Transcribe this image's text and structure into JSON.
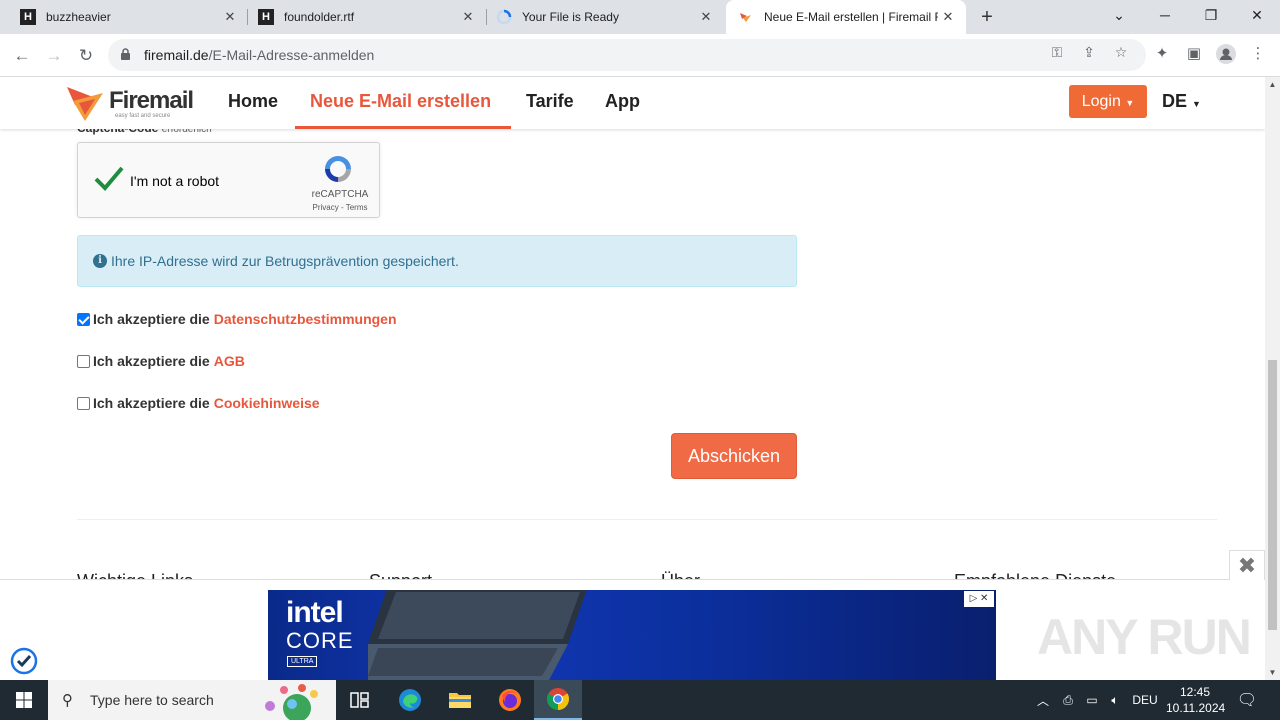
{
  "browser": {
    "tabs": [
      {
        "title": "buzzheavier",
        "favicon": "H",
        "active": false
      },
      {
        "title": "foundolder.rtf",
        "favicon": "H",
        "active": false
      },
      {
        "title": "Your File is Ready",
        "favicon": "loading-icon",
        "active": false
      },
      {
        "title": "Neue E-Mail erstellen | Firemail F",
        "favicon": "firemail-icon",
        "active": true
      }
    ],
    "url_domain": "firemail.de",
    "url_path": "/E-Mail-Adresse-anmelden"
  },
  "site": {
    "logo_text": "Firemail",
    "logo_tagline": "easy fast and secure",
    "nav": [
      "Home",
      "Neue E-Mail erstellen",
      "Tarife",
      "App"
    ],
    "login_label": "Login",
    "lang_label": "DE",
    "accent_color": "#e8573c"
  },
  "form": {
    "captcha_label": "Captcha-Code",
    "captcha_sub": "erforderlich",
    "recaptcha_label": "I'm not a robot",
    "recaptcha_brand": "reCAPTCHA",
    "recaptcha_terms": "Privacy - Terms",
    "info_text": "Ihre IP-Adresse wird zur Betrugsprävention gespeichert.",
    "checkboxes": [
      {
        "prefix": "Ich akzeptiere die",
        "link": "Datenschutzbestimmungen",
        "checked": true
      },
      {
        "prefix": "Ich akzeptiere die",
        "link": "AGB",
        "checked": false
      },
      {
        "prefix": "Ich akzeptiere die",
        "link": "Cookiehinweise",
        "checked": false
      }
    ],
    "submit_label": "Abschicken"
  },
  "footer": {
    "headings": [
      "Wichtige Links",
      "Support",
      "Über",
      "Empfohlene Dienste"
    ]
  },
  "ad": {
    "brand": "intel",
    "product": "CORE",
    "tier": "ULTRA"
  },
  "watermark": "ANY RUN",
  "taskbar": {
    "search_placeholder": "Type here to search",
    "lang": "DEU",
    "time": "12:45",
    "date": "10.11.2024"
  }
}
